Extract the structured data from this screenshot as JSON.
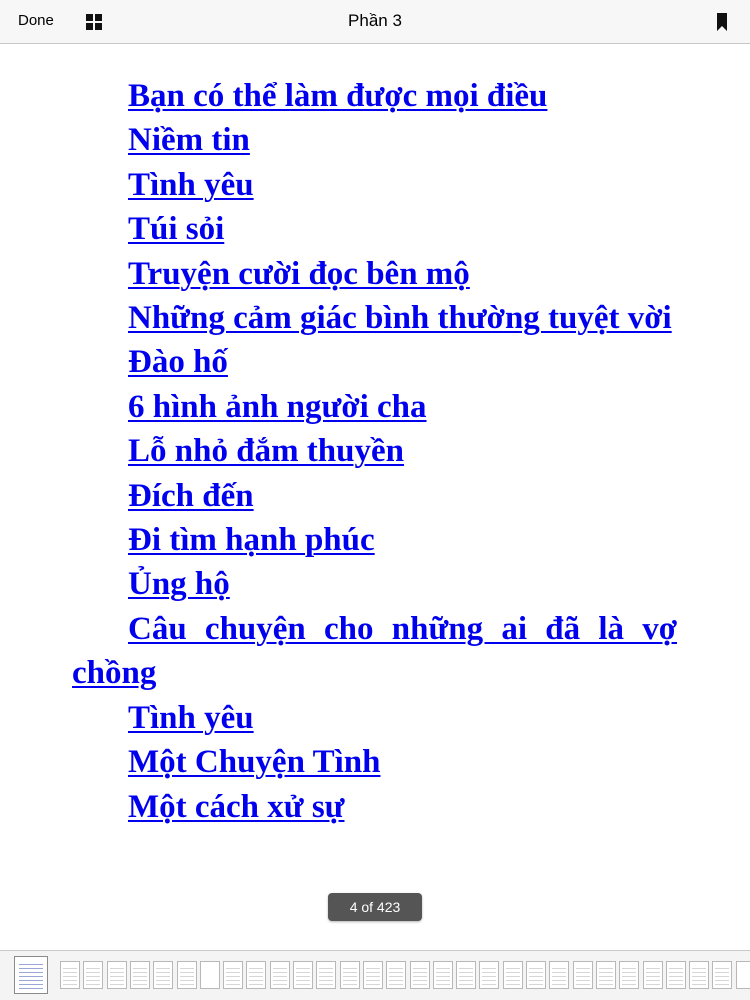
{
  "topbar": {
    "done_label": "Done",
    "title": "Phần 3",
    "grid_icon": "grid-icon",
    "bookmark_icon": "bookmark-icon"
  },
  "toc": {
    "items": [
      "Bạn có thể làm được mọi điều",
      "Niềm tin",
      "Tình yêu",
      "Túi sỏi",
      "Truyện cười đọc bên mộ",
      "Những cảm giác bình thường tuyệt vời",
      "Đào hố",
      "6 hình ảnh người cha",
      "Lỗ nhỏ đắm thuyền",
      "Đích đến",
      "Đi tìm hạnh phúc",
      "Ủng hộ",
      "Câu chuyện cho những ai đã là vợ chồng",
      "Tình yêu",
      "Một Chuyện Tình",
      "Một cách xử sự"
    ],
    "link_color": "#0000ee"
  },
  "page_indicator": "4 of 423",
  "thumbstrip": {
    "thumb_count": 31,
    "current_index": 0
  }
}
